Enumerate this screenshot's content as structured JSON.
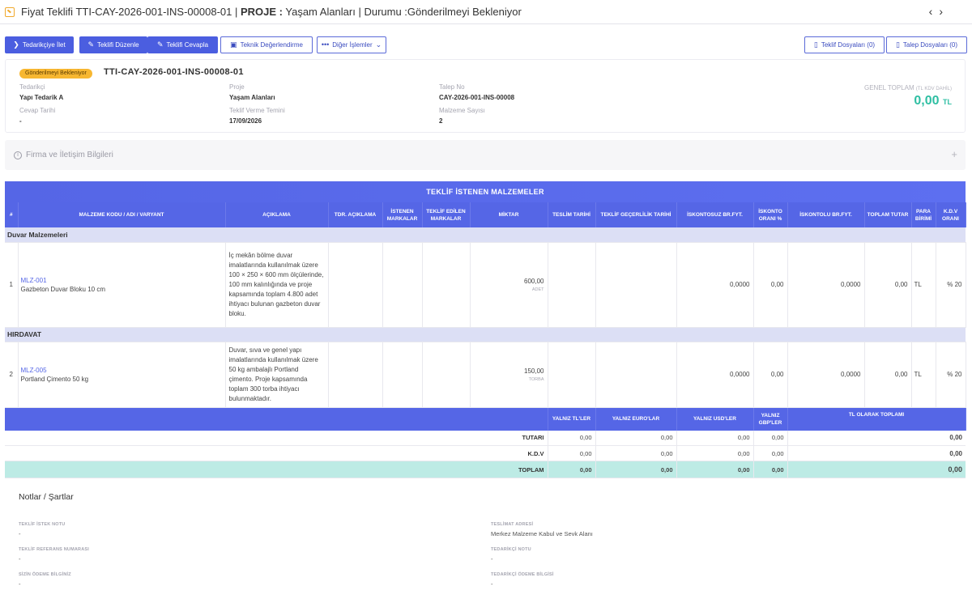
{
  "header": {
    "title_prefix": "Fiyat Teklifi",
    "title_rest": " TTI-CAY-2026-001-INS-00008-01 | ",
    "title_proje_label": "PROJE :",
    "title_proje_value": " Yaşam Alanları | Durumu :Gönderilmeyi Bekleniyor",
    "prev_icon": "‹",
    "next_icon": "›"
  },
  "toolbar": {
    "send_supplier": "Tedarikçiye İlet",
    "edit_offer": "Teklifi Düzenle",
    "reply_offer": "Teklifi Cevapla",
    "tech_eval": "Teknik Değerlendirme",
    "other_actions": "Diğer İşlemler",
    "offer_files": "Teklif Dosyaları (0)",
    "request_files": "Talep Dosyaları (0)"
  },
  "summary_card": {
    "status": "Gönderilmeyi Bekleniyor",
    "doc_no": "TTI-CAY-2026-001-INS-00008-01",
    "supplier_label": "Tedarikçi",
    "supplier_value": "Yapı Tedarik A",
    "reply_date_label": "Cevap Tarihi",
    "reply_date_value": "-",
    "project_label": "Proje",
    "project_value": "Yaşam Alanları",
    "offer_deadline_label": "Teklif Verme Temini",
    "offer_deadline_value": "17/09/2026",
    "request_no_label": "Talep No",
    "request_no_value": "CAY-2026-001-INS-00008",
    "material_count_label": "Malzeme Sayısı",
    "material_count_value": "2",
    "grand_total_label": "GENEL TOPLAM",
    "grand_total_note": "(TL KDV DAHİL)",
    "grand_total_value": "0,00",
    "grand_total_currency": "TL"
  },
  "firm_info": {
    "label": "Firma ve İletişim Bilgileri",
    "info_icon": "i",
    "plus_icon": "+"
  },
  "materials": {
    "title": "TEKLİF İSTENEN MALZEMELER",
    "columns": [
      "#",
      "MALZEME KODU / ADI / VARYANT",
      "AÇIKLAMA",
      "TDR. AÇIKLAMA",
      "İSTENEN MARKALAR",
      "TEKLİF EDİLEN MARKALAR",
      "MİKTAR",
      "TESLİM TARİHİ",
      "TEKLİF GEÇERLİLİK TARİHİ",
      "İSKONTOSUZ BR.FYT.",
      "İSKONTO ORANI %",
      "İSKONTOLU BR.FYT.",
      "TOPLAM TUTAR",
      "PARA BİRİMİ",
      "K.D.V ORANI"
    ],
    "groups": [
      {
        "name": "Duvar Malzemeleri",
        "item": {
          "no": "1",
          "code": "MLZ-001",
          "name": "Gazbeton Duvar Bloku 10 cm",
          "desc": "İç mekân bölme duvar imalatlarında kullanılmak üzere 100 × 250 × 600 mm ölçülerinde, 100 mm kalınlığında ve proje kapsamında toplam 4.800 adet ihtiyacı bulunan gazbeton duvar bloku.",
          "qty": "600,00",
          "unit": "ADET",
          "unit_price": "0,0000",
          "discount": "0,00",
          "disc_price": "0,0000",
          "total": "0,00",
          "currency": "TL",
          "vat": "% 20"
        }
      },
      {
        "name": "HIRDAVAT",
        "item": {
          "no": "2",
          "code": "MLZ-005",
          "name": "Portland Çimento 50 kg",
          "desc": "Duvar, sıva ve genel yapı imalatlarında kullanılmak üzere 50 kg ambalajlı Portland çimento. Proje kapsamında toplam 300 torba ihtiyacı bulunmaktadır.",
          "qty": "150,00",
          "unit": "TORBA",
          "unit_price": "0,0000",
          "discount": "0,00",
          "disc_price": "0,0000",
          "total": "0,00",
          "currency": "TL",
          "vat": "% 20"
        }
      }
    ]
  },
  "totals": {
    "headers": [
      "YALNIZ TL'LER",
      "YALNIZ EURO'LAR",
      "YALNIZ USD'LER",
      "YALNIZ GBP'LER",
      "TL OLARAK TOPLAMI"
    ],
    "rows": [
      {
        "label": "TUTARI",
        "tl": "0,00",
        "eur": "0,00",
        "usd": "0,00",
        "gbp": "0,00",
        "sum": "0,00"
      },
      {
        "label": "K.D.V",
        "tl": "0,00",
        "eur": "0,00",
        "usd": "0,00",
        "gbp": "0,00",
        "sum": "0,00"
      },
      {
        "label": "TOPLAM",
        "tl": "0,00",
        "eur": "0,00",
        "usd": "0,00",
        "gbp": "0,00",
        "sum": "0,00"
      }
    ]
  },
  "notes": {
    "title": "Notlar / Şartlar",
    "request_note_label": "TEKLİF İSTEK NOTU",
    "request_note_value": "-",
    "ref_no_label": "TEKLİF REFERANS NUMARASI",
    "ref_no_value": "-",
    "payment_label": "SİZİN ÖDEME BİLGİNİZ",
    "payment_value": "-",
    "delivery_addr_label": "TESLİMAT ADRESİ",
    "delivery_addr_value": "Merkez Malzeme Kabul ve Sevk Alanı",
    "supplier_note_label": "TEDARİKÇİ NOTU",
    "supplier_note_value": "-",
    "supplier_payment_label": "TEDARİKÇİ ÖDEME BİLGİSİ",
    "supplier_payment_value": "-"
  }
}
